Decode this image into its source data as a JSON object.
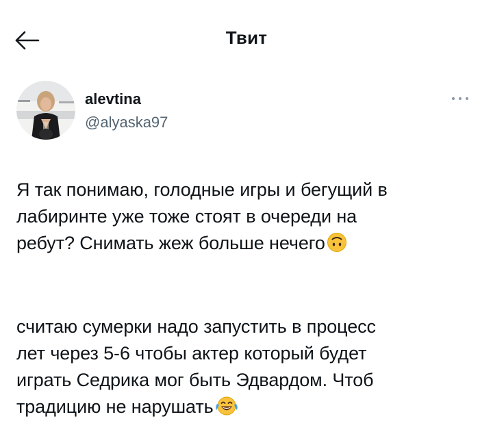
{
  "header": {
    "title": "Твит",
    "back_icon": "arrow-left-icon"
  },
  "author": {
    "display_name": "alevtina",
    "handle": "@alyaska97",
    "avatar_icon": "profile-avatar",
    "more_icon": "more-horizontal-icon"
  },
  "tweet": {
    "lines_p1": [
      "Я так понимаю, голодные игры и бегущий в",
      "лабиринте уже тоже стоят в очереди на",
      "ребут? Снимать жеж больше нечего"
    ],
    "emoji_p1": "upside-down-face-emoji",
    "lines_p2": [
      "считаю сумерки надо запустить в процесс",
      "лет через 5-6 чтобы актер который будет",
      "играть Седрика мог быть Эдвардом. Чтоб",
      "традицию не нарушать"
    ],
    "emoji_p2": "face-with-tears-of-joy-emoji"
  },
  "colors": {
    "text": "#0f1419",
    "secondary": "#536471",
    "emoji_yellow": "#f9c23c",
    "emoji_blue": "#4aa3df"
  }
}
